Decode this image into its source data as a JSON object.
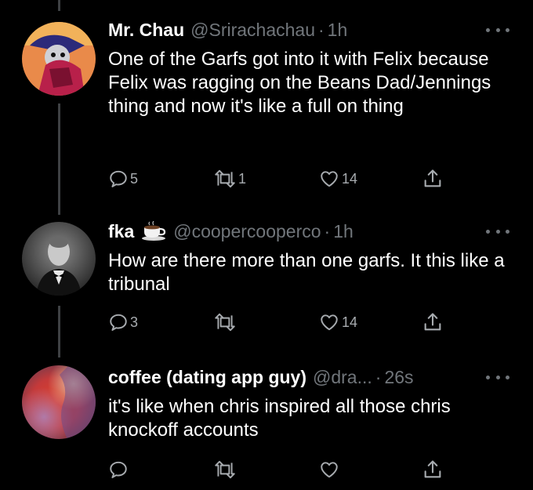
{
  "colors": {
    "background": "#000000",
    "text_primary": "#ffffff",
    "text_muted": "#71767b",
    "thread_line": "#3e4144"
  },
  "tweets": [
    {
      "display_name": "Mr. Chau",
      "handle": "@Srirachachau",
      "separator": "·",
      "time": "1h",
      "text": "One of the Garfs got into it with Felix because Felix was ragging on the Beans Dad/Jennings thing and now it's like a full on thing",
      "reply_count": "5",
      "retweet_count": "1",
      "like_count": "14",
      "share_count": "",
      "avatar_icon": "cartoon-avatar"
    },
    {
      "display_name": "fka",
      "name_emoji": "coffee-cup-icon",
      "handle": "@coopercooperco",
      "separator": "·",
      "time": "1h",
      "text": "How are there more than one garfs. It this like a tribunal",
      "reply_count": "3",
      "retweet_count": "",
      "like_count": "14",
      "share_count": "",
      "avatar_icon": "photo-avatar"
    },
    {
      "display_name": "coffee (dating app guy)",
      "handle": "@dra...",
      "separator": "·",
      "time": "26s",
      "text": "it's like when chris inspired all those chris knockoff accounts",
      "reply_count": "",
      "retweet_count": "",
      "like_count": "",
      "share_count": "",
      "avatar_icon": "blurred-avatar"
    }
  ]
}
